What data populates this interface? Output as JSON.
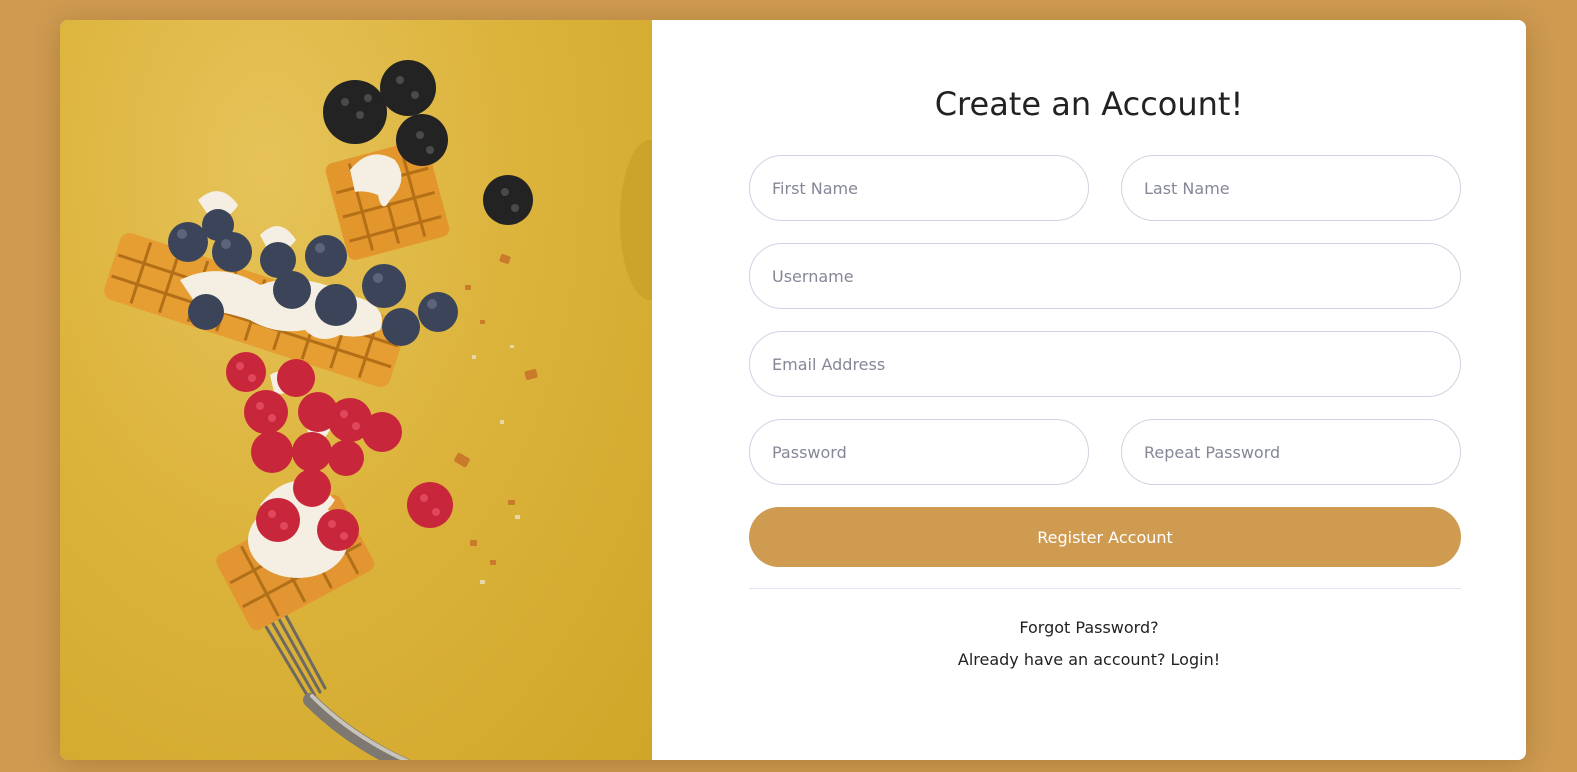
{
  "page": {
    "background_color": "#cf9b51",
    "accent_color": "#cf9b51"
  },
  "hero": {
    "image_subject": "waffle-pieces-with-berries-and-cream-on-fork",
    "background_color": "#d8b03a"
  },
  "form": {
    "title": "Create an Account!",
    "first_name": {
      "placeholder": "First Name",
      "value": ""
    },
    "last_name": {
      "placeholder": "Last Name",
      "value": ""
    },
    "username": {
      "placeholder": "Username",
      "value": ""
    },
    "email": {
      "placeholder": "Email Address",
      "value": ""
    },
    "password": {
      "placeholder": "Password",
      "value": ""
    },
    "repeat_password": {
      "placeholder": "Repeat Password",
      "value": ""
    },
    "register_label": "Register Account",
    "forgot_password_label": "Forgot Password?",
    "login_label": "Already have an account? Login!"
  }
}
